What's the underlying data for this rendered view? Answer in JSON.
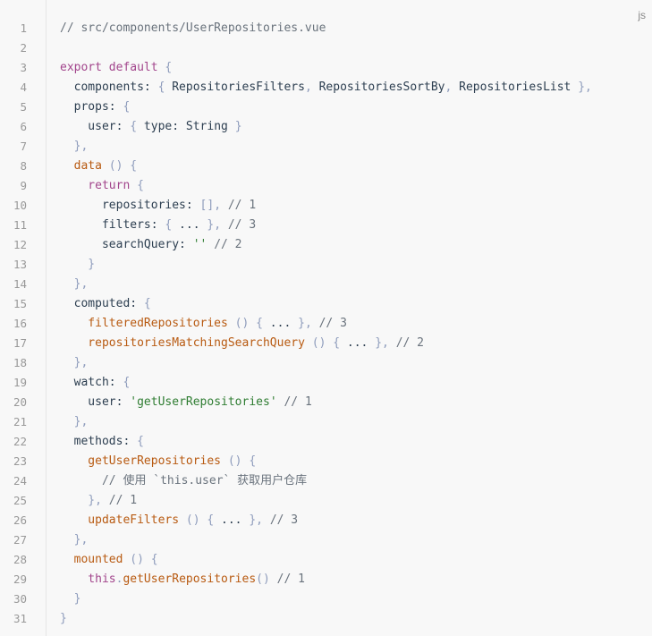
{
  "lang_label": "js",
  "lines": [
    {
      "n": "1",
      "tokens": [
        {
          "t": "comment",
          "v": "// src/components/UserRepositories.vue"
        }
      ]
    },
    {
      "n": "2",
      "tokens": []
    },
    {
      "n": "3",
      "tokens": [
        {
          "t": "keyword",
          "v": "export default"
        },
        {
          "t": "text",
          "v": " "
        },
        {
          "t": "punct",
          "v": "{"
        }
      ]
    },
    {
      "n": "4",
      "tokens": [
        {
          "t": "text",
          "v": "  components: "
        },
        {
          "t": "punct",
          "v": "{"
        },
        {
          "t": "text",
          "v": " RepositoriesFilters"
        },
        {
          "t": "punct",
          "v": ","
        },
        {
          "t": "text",
          "v": " RepositoriesSortBy"
        },
        {
          "t": "punct",
          "v": ","
        },
        {
          "t": "text",
          "v": " RepositoriesList "
        },
        {
          "t": "punct",
          "v": "},"
        }
      ]
    },
    {
      "n": "5",
      "tokens": [
        {
          "t": "text",
          "v": "  props: "
        },
        {
          "t": "punct",
          "v": "{"
        }
      ]
    },
    {
      "n": "6",
      "tokens": [
        {
          "t": "text",
          "v": "    user: "
        },
        {
          "t": "punct",
          "v": "{"
        },
        {
          "t": "text",
          "v": " type: String "
        },
        {
          "t": "punct",
          "v": "}"
        }
      ]
    },
    {
      "n": "7",
      "tokens": [
        {
          "t": "punct",
          "v": "  },"
        }
      ]
    },
    {
      "n": "8",
      "tokens": [
        {
          "t": "fn",
          "v": "  data"
        },
        {
          "t": "text",
          "v": " "
        },
        {
          "t": "punct",
          "v": "() {"
        }
      ]
    },
    {
      "n": "9",
      "tokens": [
        {
          "t": "keyword",
          "v": "    return"
        },
        {
          "t": "text",
          "v": " "
        },
        {
          "t": "punct",
          "v": "{"
        }
      ]
    },
    {
      "n": "10",
      "tokens": [
        {
          "t": "text",
          "v": "      repositories: "
        },
        {
          "t": "punct",
          "v": "[],"
        },
        {
          "t": "text",
          "v": " "
        },
        {
          "t": "comment",
          "v": "// 1"
        }
      ]
    },
    {
      "n": "11",
      "tokens": [
        {
          "t": "text",
          "v": "      filters: "
        },
        {
          "t": "punct",
          "v": "{"
        },
        {
          "t": "text",
          "v": " ... "
        },
        {
          "t": "punct",
          "v": "},"
        },
        {
          "t": "text",
          "v": " "
        },
        {
          "t": "comment",
          "v": "// 3"
        }
      ]
    },
    {
      "n": "12",
      "tokens": [
        {
          "t": "text",
          "v": "      searchQuery: "
        },
        {
          "t": "str",
          "v": "''"
        },
        {
          "t": "text",
          "v": " "
        },
        {
          "t": "comment",
          "v": "// 2"
        }
      ]
    },
    {
      "n": "13",
      "tokens": [
        {
          "t": "punct",
          "v": "    }"
        }
      ]
    },
    {
      "n": "14",
      "tokens": [
        {
          "t": "punct",
          "v": "  },"
        }
      ]
    },
    {
      "n": "15",
      "tokens": [
        {
          "t": "text",
          "v": "  computed: "
        },
        {
          "t": "punct",
          "v": "{"
        }
      ]
    },
    {
      "n": "16",
      "tokens": [
        {
          "t": "fn",
          "v": "    filteredRepositories"
        },
        {
          "t": "text",
          "v": " "
        },
        {
          "t": "punct",
          "v": "() {"
        },
        {
          "t": "text",
          "v": " ... "
        },
        {
          "t": "punct",
          "v": "},"
        },
        {
          "t": "text",
          "v": " "
        },
        {
          "t": "comment",
          "v": "// 3"
        }
      ]
    },
    {
      "n": "17",
      "tokens": [
        {
          "t": "fn",
          "v": "    repositoriesMatchingSearchQuery"
        },
        {
          "t": "text",
          "v": " "
        },
        {
          "t": "punct",
          "v": "() {"
        },
        {
          "t": "text",
          "v": " ... "
        },
        {
          "t": "punct",
          "v": "},"
        },
        {
          "t": "text",
          "v": " "
        },
        {
          "t": "comment",
          "v": "// 2"
        }
      ]
    },
    {
      "n": "18",
      "tokens": [
        {
          "t": "punct",
          "v": "  },"
        }
      ]
    },
    {
      "n": "19",
      "tokens": [
        {
          "t": "text",
          "v": "  watch: "
        },
        {
          "t": "punct",
          "v": "{"
        }
      ]
    },
    {
      "n": "20",
      "tokens": [
        {
          "t": "text",
          "v": "    user: "
        },
        {
          "t": "str",
          "v": "'getUserRepositories'"
        },
        {
          "t": "text",
          "v": " "
        },
        {
          "t": "comment",
          "v": "// 1"
        }
      ]
    },
    {
      "n": "21",
      "tokens": [
        {
          "t": "punct",
          "v": "  },"
        }
      ]
    },
    {
      "n": "22",
      "tokens": [
        {
          "t": "text",
          "v": "  methods: "
        },
        {
          "t": "punct",
          "v": "{"
        }
      ]
    },
    {
      "n": "23",
      "tokens": [
        {
          "t": "fn",
          "v": "    getUserRepositories"
        },
        {
          "t": "text",
          "v": " "
        },
        {
          "t": "punct",
          "v": "() {"
        }
      ]
    },
    {
      "n": "24",
      "tokens": [
        {
          "t": "comment",
          "v": "      // 使用 `this.user` 获取用户仓库"
        }
      ]
    },
    {
      "n": "25",
      "tokens": [
        {
          "t": "punct",
          "v": "    },"
        },
        {
          "t": "text",
          "v": " "
        },
        {
          "t": "comment",
          "v": "// 1"
        }
      ]
    },
    {
      "n": "26",
      "tokens": [
        {
          "t": "fn",
          "v": "    updateFilters"
        },
        {
          "t": "text",
          "v": " "
        },
        {
          "t": "punct",
          "v": "() {"
        },
        {
          "t": "text",
          "v": " ... "
        },
        {
          "t": "punct",
          "v": "},"
        },
        {
          "t": "text",
          "v": " "
        },
        {
          "t": "comment",
          "v": "// 3"
        }
      ]
    },
    {
      "n": "27",
      "tokens": [
        {
          "t": "punct",
          "v": "  },"
        }
      ]
    },
    {
      "n": "28",
      "tokens": [
        {
          "t": "fn",
          "v": "  mounted"
        },
        {
          "t": "text",
          "v": " "
        },
        {
          "t": "punct",
          "v": "() {"
        }
      ]
    },
    {
      "n": "29",
      "tokens": [
        {
          "t": "keyword",
          "v": "    this"
        },
        {
          "t": "punct",
          "v": "."
        },
        {
          "t": "fn",
          "v": "getUserRepositories"
        },
        {
          "t": "punct",
          "v": "()"
        },
        {
          "t": "text",
          "v": " "
        },
        {
          "t": "comment",
          "v": "// 1"
        }
      ]
    },
    {
      "n": "30",
      "tokens": [
        {
          "t": "punct",
          "v": "  }"
        }
      ]
    },
    {
      "n": "31",
      "tokens": [
        {
          "t": "punct",
          "v": "}"
        }
      ]
    }
  ]
}
